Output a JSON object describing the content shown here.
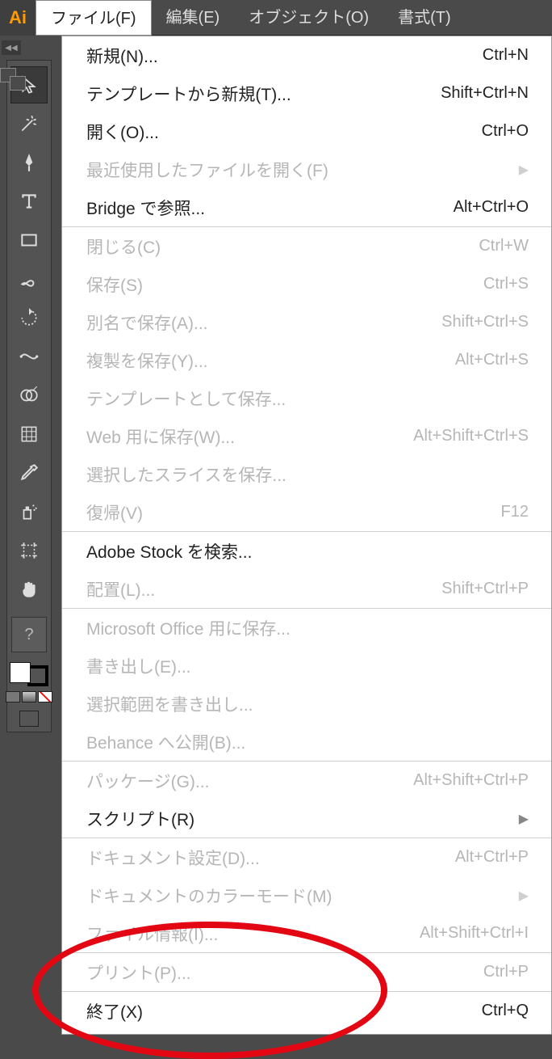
{
  "app": {
    "logo_text": "Ai"
  },
  "menubar": {
    "file": "ファイル(F)",
    "edit": "編集(E)",
    "object": "オブジェクト(O)",
    "type": "書式(T)"
  },
  "help_label": "?",
  "menu": {
    "groups": [
      [
        {
          "key": "new",
          "label": "新規(N)...",
          "shortcut": "Ctrl+N",
          "enabled": true
        },
        {
          "key": "new-from-template",
          "label": "テンプレートから新規(T)...",
          "shortcut": "Shift+Ctrl+N",
          "enabled": true
        },
        {
          "key": "open",
          "label": "開く(O)...",
          "shortcut": "Ctrl+O",
          "enabled": true
        },
        {
          "key": "open-recent",
          "label": "最近使用したファイルを開く(F)",
          "shortcut": "",
          "enabled": false,
          "submenu": true
        },
        {
          "key": "browse-bridge",
          "label": "Bridge で参照...",
          "shortcut": "Alt+Ctrl+O",
          "enabled": true
        }
      ],
      [
        {
          "key": "close",
          "label": "閉じる(C)",
          "shortcut": "Ctrl+W",
          "enabled": false
        },
        {
          "key": "save",
          "label": "保存(S)",
          "shortcut": "Ctrl+S",
          "enabled": false
        },
        {
          "key": "save-as",
          "label": "別名で保存(A)...",
          "shortcut": "Shift+Ctrl+S",
          "enabled": false
        },
        {
          "key": "save-copy",
          "label": "複製を保存(Y)...",
          "shortcut": "Alt+Ctrl+S",
          "enabled": false
        },
        {
          "key": "save-as-template",
          "label": "テンプレートとして保存...",
          "shortcut": "",
          "enabled": false
        },
        {
          "key": "save-for-web",
          "label": "Web 用に保存(W)...",
          "shortcut": "Alt+Shift+Ctrl+S",
          "enabled": false
        },
        {
          "key": "save-selected-slices",
          "label": "選択したスライスを保存...",
          "shortcut": "",
          "enabled": false
        },
        {
          "key": "revert",
          "label": "復帰(V)",
          "shortcut": "F12",
          "enabled": false
        }
      ],
      [
        {
          "key": "search-adobe-stock",
          "label": "Adobe Stock を検索...",
          "shortcut": "",
          "enabled": true
        },
        {
          "key": "place",
          "label": "配置(L)...",
          "shortcut": "Shift+Ctrl+P",
          "enabled": false
        }
      ],
      [
        {
          "key": "save-ms-office",
          "label": "Microsoft Office 用に保存...",
          "shortcut": "",
          "enabled": false
        },
        {
          "key": "export",
          "label": "書き出し(E)...",
          "shortcut": "",
          "enabled": false
        },
        {
          "key": "export-selection",
          "label": "選択範囲を書き出し...",
          "shortcut": "",
          "enabled": false
        },
        {
          "key": "share-behance",
          "label": "Behance へ公開(B)...",
          "shortcut": "",
          "enabled": false
        }
      ],
      [
        {
          "key": "package",
          "label": "パッケージ(G)...",
          "shortcut": "Alt+Shift+Ctrl+P",
          "enabled": false
        },
        {
          "key": "scripts",
          "label": "スクリプト(R)",
          "shortcut": "",
          "enabled": true,
          "submenu": true
        }
      ],
      [
        {
          "key": "document-setup",
          "label": "ドキュメント設定(D)...",
          "shortcut": "Alt+Ctrl+P",
          "enabled": false
        },
        {
          "key": "document-color-mode",
          "label": "ドキュメントのカラーモード(M)",
          "shortcut": "",
          "enabled": false,
          "submenu": true
        },
        {
          "key": "file-info",
          "label": "ファイル情報(I)...",
          "shortcut": "Alt+Shift+Ctrl+I",
          "enabled": false
        }
      ],
      [
        {
          "key": "print",
          "label": "プリント(P)...",
          "shortcut": "Ctrl+P",
          "enabled": false
        }
      ],
      [
        {
          "key": "exit",
          "label": "終了(X)",
          "shortcut": "Ctrl+Q",
          "enabled": true
        }
      ]
    ]
  }
}
